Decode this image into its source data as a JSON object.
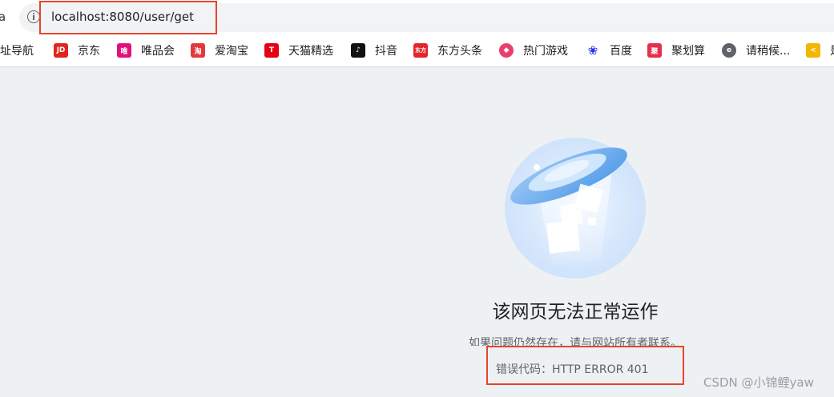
{
  "browser": {
    "left_fragment": "a",
    "url": "localhost:8080/user/get",
    "info_icon": "info-icon"
  },
  "bookmarks": [
    {
      "label": "网址导航",
      "icon": "nav-icon",
      "color": "#ffffff",
      "glyph": ""
    },
    {
      "label": "京东",
      "icon": "jd-icon",
      "color": "#e1251b",
      "glyph": "JD"
    },
    {
      "label": "唯品会",
      "icon": "vip-icon",
      "color": "#e0117f",
      "glyph": "唯"
    },
    {
      "label": "爱淘宝",
      "icon": "taobao-icon",
      "color": "#e4393c",
      "glyph": "淘"
    },
    {
      "label": "天猫精选",
      "icon": "tmall-icon",
      "color": "#e60012",
      "glyph": "T"
    },
    {
      "label": "抖音",
      "icon": "douyin-icon",
      "color": "#111111",
      "glyph": "♪"
    },
    {
      "label": "东方头条",
      "icon": "dftt-icon",
      "color": "#e4252a",
      "glyph": "东方"
    },
    {
      "label": "热门游戏",
      "icon": "game-icon",
      "color": "#ea3f6d",
      "glyph": "◆"
    },
    {
      "label": "百度",
      "icon": "baidu-icon",
      "color": "#2932e1",
      "glyph": "❀"
    },
    {
      "label": "聚划算",
      "icon": "juhuasuan-icon",
      "color": "#e62e4b",
      "glyph": "聚"
    },
    {
      "label": "请稍候...",
      "icon": "loading-icon",
      "color": "#5f6368",
      "glyph": "e"
    },
    {
      "label": "是",
      "icon": "partial-icon",
      "color": "#f2b705",
      "glyph": "<"
    }
  ],
  "error": {
    "title": "该网页无法正常运作",
    "subtitle": "如果问题仍然存在，请与网站所有者联系。",
    "code_label": "错误代码：HTTP ERROR 401",
    "illustration": "ufo-icon"
  },
  "watermark": "CSDN @小锦鲤yaw",
  "colors": {
    "highlight": "#e8442a",
    "background": "#eef1f4"
  }
}
